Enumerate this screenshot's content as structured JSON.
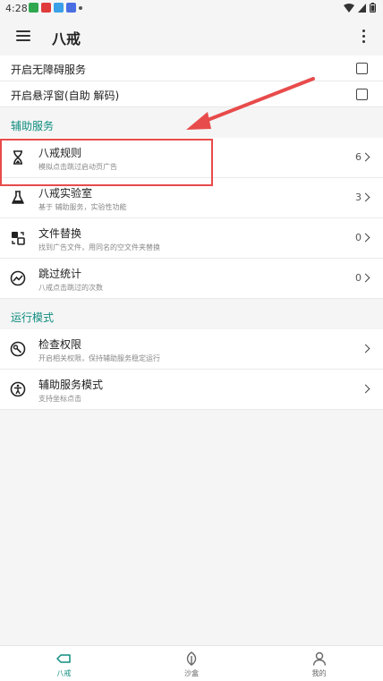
{
  "status": {
    "time": "4:28"
  },
  "appbar": {
    "title": "八戒"
  },
  "settings": [
    {
      "label": "开启无障碍服务"
    },
    {
      "label": "开启悬浮窗(自助 解码)"
    }
  ],
  "sections": {
    "assist": "辅助服务",
    "run_mode": "运行模式"
  },
  "assist_items": [
    {
      "title": "八戒规则",
      "subtitle": "模拟点击跳过启动页广告",
      "count": "6"
    },
    {
      "title": "八戒实验室",
      "subtitle": "基于 辅助服务，实验性功能",
      "count": "3"
    },
    {
      "title": "文件替换",
      "subtitle": "找到广告文件，用同名的空文件夹替换",
      "count": "0"
    },
    {
      "title": "跳过统计",
      "subtitle": "八戒点击跳过的次数",
      "count": "0"
    }
  ],
  "run_items": [
    {
      "title": "检查权限",
      "subtitle": "开启相关权限，保持辅助服务稳定运行"
    },
    {
      "title": "辅助服务模式",
      "subtitle": "支持坐标点击"
    }
  ],
  "tabs": [
    {
      "label": "八戒",
      "icon": "pig-tab-icon"
    },
    {
      "label": "沙盒",
      "icon": "leaf-tab-icon"
    },
    {
      "label": "我的",
      "icon": "person-tab-icon"
    }
  ],
  "colors": {
    "accent": "#0f8d7f",
    "highlight": "#e84b4b"
  }
}
